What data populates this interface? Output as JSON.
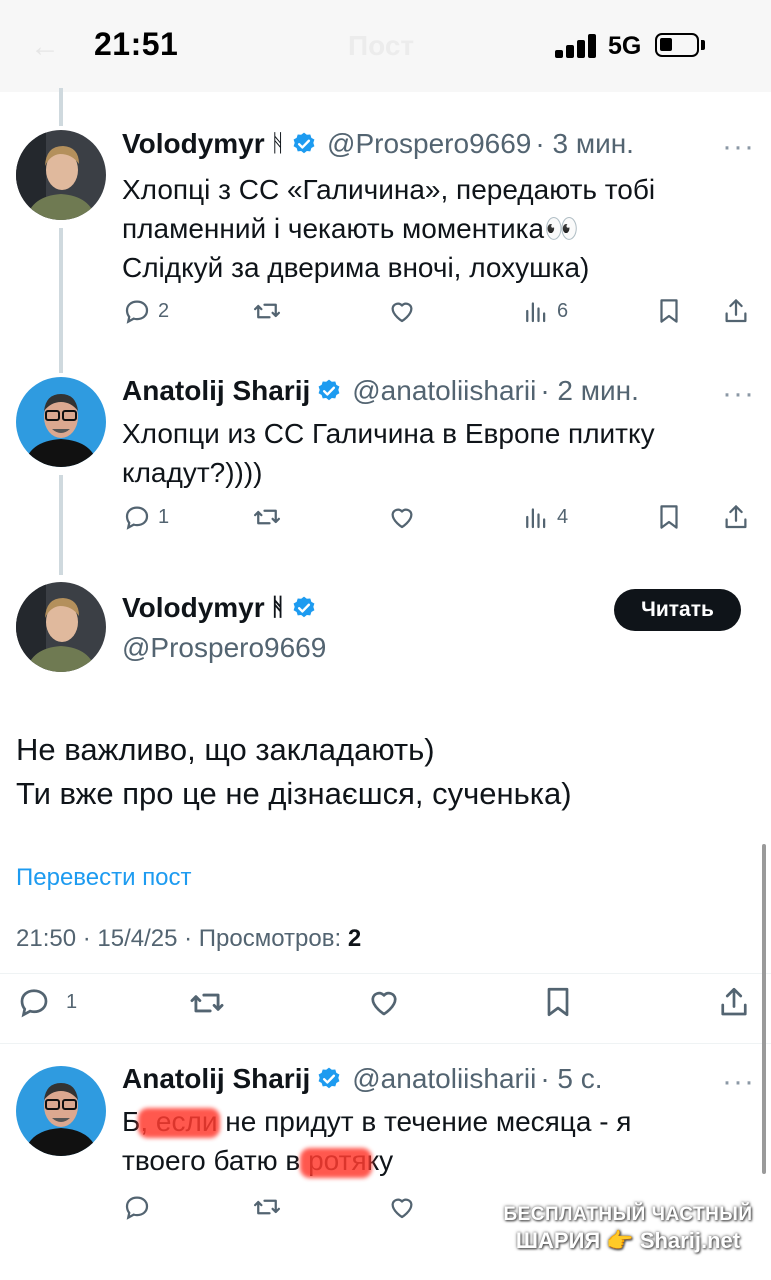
{
  "status_bar": {
    "time": "21:51",
    "network": "5G",
    "title": "Пост"
  },
  "colors": {
    "accent": "#1d9bf0",
    "verified": "#1d9bf0",
    "text": "#0f1419",
    "muted": "#536471"
  },
  "icons": [
    "reply-icon",
    "retweet-icon",
    "like-icon",
    "views-icon",
    "bookmark-icon",
    "share-icon",
    "verified-icon",
    "more-icon"
  ],
  "tweets": [
    {
      "name": "Volodymyr",
      "rune": "ᚻ",
      "handle": "@Prospero9669",
      "time": "· 3 мин.",
      "lines": [
        "Хлопці з СС «Галичина», передають тобі",
        "пламенний і чекають моментика👀",
        "Слідкуй за дверима вночі, лохушка)"
      ],
      "replies": "2",
      "views": "6"
    },
    {
      "name": "Anatolij Sharij",
      "handle": "@anatoliisharii",
      "time": "· 2 мин.",
      "lines": [
        "Хлопци из СС Галичина в Европе плитку",
        "кладут?))))"
      ],
      "replies": "1",
      "views": "4"
    }
  ],
  "main_post": {
    "name": "Volodymyr",
    "rune": "ᚻ",
    "handle": "@Prospero9669",
    "follow_label": "Читать",
    "lines": [
      "Не важливо, що закладають)",
      "Ти вже про це не дізнаєшся, сученька)"
    ],
    "translate_label": "Перевести пост",
    "meta_prefix": "21:50 · 15/4/25 · Просмотров: ",
    "views": "2",
    "replies": "1"
  },
  "reply": {
    "name": "Anatolij Sharij",
    "handle": "@anatoliisharii",
    "time": "· 5 с.",
    "lines": [
      "Б, если не придут в течение месяца - я",
      "твоего батю в ротяку"
    ]
  },
  "watermark": {
    "line1": "БЕСПЛАТНЫЙ ЧАСТНЫЙ",
    "line2": "ШАРИЯ 👉 Sharij.net"
  }
}
